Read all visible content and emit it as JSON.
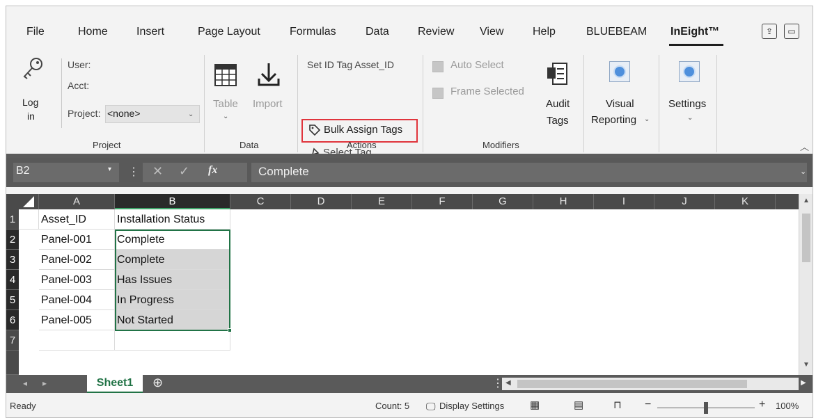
{
  "tabs": [
    "File",
    "Home",
    "Insert",
    "Page Layout",
    "Formulas",
    "Data",
    "Review",
    "View",
    "Help",
    "BLUEBEAM",
    "InEight™"
  ],
  "ribbon": {
    "project": {
      "log_in_1": "Log",
      "log_in_2": "in",
      "user_label": "User:",
      "acct_label": "Acct:",
      "project_label": "Project:",
      "project_value": "<none>",
      "group_label": "Project"
    },
    "data": {
      "table_label": "Table",
      "import_label": "Import",
      "group_label": "Data"
    },
    "actions": {
      "set_id_tag": "Set ID Tag  Asset_ID",
      "bulk_assign": "Bulk Assign Tags",
      "select_tag": "Select Tag",
      "group_label": "Actions"
    },
    "modifiers": {
      "auto_select": "Auto Select",
      "frame_selected": "Frame Selected",
      "audit_1": "Audit",
      "audit_2": "Tags",
      "group_label": "Modifiers"
    },
    "visual_1": "Visual",
    "visual_2": "Reporting",
    "settings": "Settings"
  },
  "formula_bar": {
    "name_box": "B2",
    "fx": "fx",
    "content": "Complete"
  },
  "columns": [
    "A",
    "B",
    "C",
    "D",
    "E",
    "F",
    "G",
    "H",
    "I",
    "J",
    "K"
  ],
  "rows": [
    {
      "num": "1",
      "a": "Asset_ID",
      "b": "Installation Status"
    },
    {
      "num": "2",
      "a": "Panel-001",
      "b": "Complete"
    },
    {
      "num": "3",
      "a": "Panel-002",
      "b": "Complete"
    },
    {
      "num": "4",
      "a": "Panel-003",
      "b": "Has Issues"
    },
    {
      "num": "5",
      "a": "Panel-004",
      "b": "In Progress"
    },
    {
      "num": "6",
      "a": "Panel-005",
      "b": "Not Started"
    },
    {
      "num": "7",
      "a": "",
      "b": ""
    }
  ],
  "sheet_tab": "Sheet1",
  "status": {
    "ready": "Ready",
    "count": "Count: 5",
    "display_settings": "Display Settings",
    "zoom": "100%"
  },
  "colors": {
    "excel_green": "#217346",
    "highlight_red": "#e0343c"
  }
}
